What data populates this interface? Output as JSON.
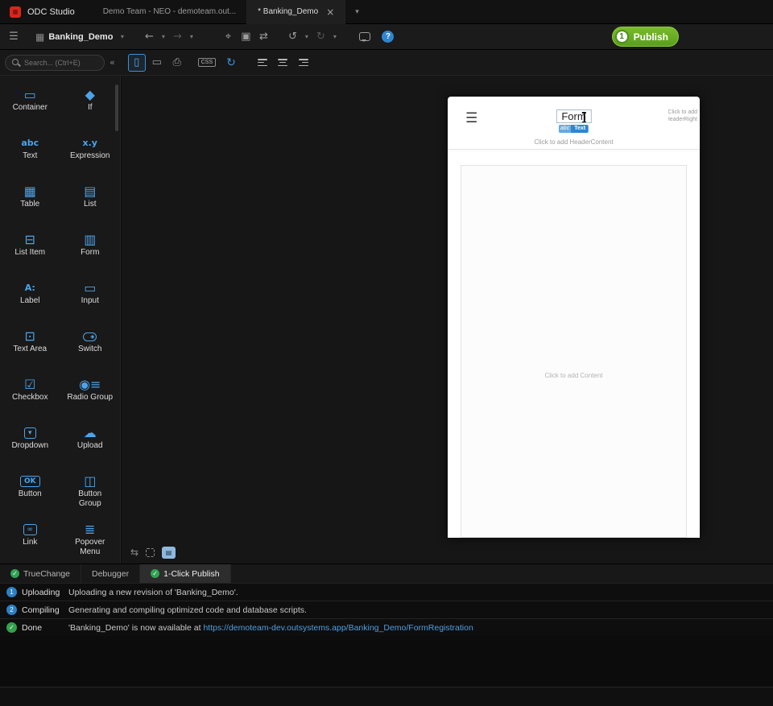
{
  "colors": {
    "accent_blue": "#4da3e8",
    "publish_green": "#5a9e1d",
    "ok_green": "#2fa352",
    "link_blue": "#4f9fe0",
    "logo_red": "#d9261c"
  },
  "titlebar": {
    "app_name": "ODC Studio",
    "env_tab": "Demo Team - NEO - demoteam.out...",
    "module_tab": "* Banking_Demo"
  },
  "icons": {
    "hamburger": "☰",
    "module_grid": "▦",
    "back": "←",
    "forward": "→",
    "caret": "▾",
    "pin": "⌖",
    "layers": "▣",
    "compare": "⇄",
    "undo": "↺",
    "redo": "↻",
    "help": "?",
    "collapse": "«",
    "phone": "▯",
    "tablet": "▭",
    "desktop": "⎙",
    "css": "CSS",
    "refresh": "↻",
    "swap": "⇆",
    "tree_chip": "▤",
    "close": "×",
    "menu": "☰",
    "check": "✓"
  },
  "toolbar": {
    "module_name": "Banking_Demo",
    "publish_label": "Publish",
    "publish_badge": "1"
  },
  "search": {
    "placeholder": "Search... (Ctrl+E)"
  },
  "widgets": [
    {
      "label": "Container",
      "icon": "container-icon",
      "glyph": "▭"
    },
    {
      "label": "If",
      "icon": "if-icon",
      "glyph": "◆"
    },
    {
      "label": "Text",
      "icon": "text-icon",
      "glyph": "abc",
      "text": true
    },
    {
      "label": "Expression",
      "icon": "expression-icon",
      "glyph": "x.y",
      "text": true
    },
    {
      "label": "Table",
      "icon": "table-icon",
      "glyph": "▦"
    },
    {
      "label": "List",
      "icon": "list-icon",
      "glyph": "▤"
    },
    {
      "label": "List Item",
      "icon": "list-item-icon",
      "glyph": "⊟"
    },
    {
      "label": "Form",
      "icon": "form-icon",
      "glyph": "▥"
    },
    {
      "label": "Label",
      "icon": "label-icon",
      "glyph": "A:",
      "text": true
    },
    {
      "label": "Input",
      "icon": "input-icon",
      "glyph": "▭"
    },
    {
      "label": "Text Area",
      "icon": "text-area-icon",
      "glyph": "⊡"
    },
    {
      "label": "Switch",
      "icon": "switch-icon",
      "glyph": "◉",
      "pill": true
    },
    {
      "label": "Checkbox",
      "icon": "checkbox-icon",
      "glyph": "☑"
    },
    {
      "label": "Radio Group",
      "icon": "radio-group-icon",
      "glyph": "◉≡"
    },
    {
      "label": "Dropdown",
      "icon": "dropdown-icon",
      "glyph": "▾",
      "boxed": true
    },
    {
      "label": "Upload",
      "icon": "upload-icon",
      "glyph": "☁"
    },
    {
      "label": "Button",
      "icon": "button-icon",
      "glyph": "OK",
      "boxed": true,
      "text": true
    },
    {
      "label": "Button Group",
      "icon": "button-group-icon",
      "glyph": "◫"
    },
    {
      "label": "Link",
      "icon": "link-icon",
      "glyph": "∞",
      "boxed": true
    },
    {
      "label": "Popover Menu",
      "icon": "popover-menu-icon",
      "glyph": "≣"
    }
  ],
  "preview": {
    "title": "Form",
    "tag_abc": "abc",
    "tag_label": "Text",
    "header_right_hint": "Click to add HeaderRight",
    "header_content_hint": "Click to add HeaderContent",
    "content_hint": "Click to add Content"
  },
  "bottom_tabs": [
    {
      "label": "TrueChange",
      "check": true,
      "active": false
    },
    {
      "label": "Debugger",
      "check": false,
      "active": false
    },
    {
      "label": "1-Click Publish",
      "check": true,
      "active": true
    }
  ],
  "publish_log": [
    {
      "badge": "1",
      "badge_type": "step",
      "label": "Uploading",
      "message": "Uploading a new revision of 'Banking_Demo'.",
      "link": ""
    },
    {
      "badge": "2",
      "badge_type": "step",
      "label": "Compiling",
      "message": "Generating and compiling optimized code and database scripts.",
      "link": ""
    },
    {
      "badge": "✓",
      "badge_type": "done",
      "label": "Done",
      "message": "'Banking_Demo' is now available at ",
      "link": "https://demoteam-dev.outsystems.app/Banking_Demo/FormRegistration"
    }
  ]
}
